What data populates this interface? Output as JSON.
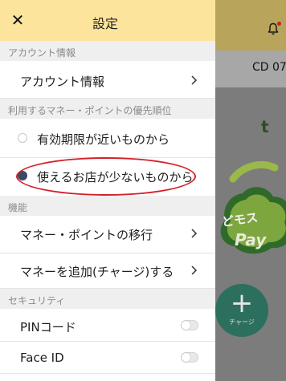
{
  "drawer": {
    "close_icon": "✕",
    "title": "設定"
  },
  "sections": {
    "account": "アカウント情報",
    "priority": "利用するマネー・ポイントの優先順位",
    "features": "機能",
    "security": "セキュリティ"
  },
  "account": {
    "account_info": "アカウント情報"
  },
  "priority": {
    "options": [
      {
        "label": "有効期限が近いものから",
        "selected": false
      },
      {
        "label": "使えるお店が少ないものから",
        "selected": true
      }
    ]
  },
  "features": {
    "transfer": "マネー・ポイントの移行",
    "charge": "マネーを追加(チャージ)する"
  },
  "security": {
    "pin": {
      "label": "PINコード",
      "enabled": false
    },
    "face_id": {
      "label": "Face ID",
      "enabled": false
    }
  },
  "background": {
    "cd_text": "CD 07",
    "partial_char": "t",
    "logo_text": "どモス",
    "logo_pay": "Pay",
    "fab_plus": "+",
    "fab_label": "チャージ"
  },
  "colors": {
    "drawer_header": "#fde49c",
    "section_bg": "#efefef",
    "highlight": "#d5212a",
    "radio_selected": "#3a4a60",
    "fab": "#2d6f5e"
  },
  "icons": {
    "close": "close-icon",
    "chevron": "chevron-right-icon",
    "notification": "bell-icon",
    "charge": "plus-icon"
  }
}
